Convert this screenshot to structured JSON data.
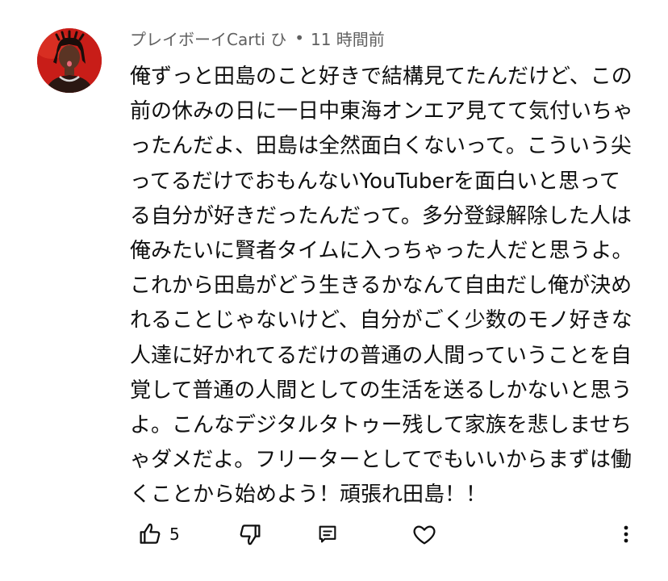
{
  "comment": {
    "author": "プレイボーイCarti ひ",
    "separator": "•",
    "timestamp": "11 時間前",
    "text": "俺ずっと田島のこと好きで結構見てたんだけど、この\n前の休みの日に一日中東海オンエア見てて気付いちゃ\nったんだよ、田島は全然面白くないって。こういう尖\nってるだけでおもんないYouTuberを面白いと思って\nる自分が好きだったんだって。多分登録解除した人は\n俺みたいに賢者タイムに入っちゃった人だと思うよ。\nこれから田島がどう生きるかなんて自由だし俺が決め\nれることじゃないけど、自分がごく少数のモノ好きな\n人達に好かれてるだけの普通の人間っていうことを自\n覚して普通の人間としての生活を送るしかないと思う\nよ。こんなデジタルタトゥー残して家族を悲しませち\nゃダメだよ。フリーターとしてでもいいからまずは働\nくことから始めよう！頑張れ田島！！",
    "like_count": "5"
  },
  "icons": {
    "avatar": "avatar-photo",
    "like": "thumbs-up-icon",
    "dislike": "thumbs-down-icon",
    "reply": "reply-icon",
    "heart": "heart-icon",
    "more": "more-vertical-icon"
  },
  "colors": {
    "text": "#0f0f0f",
    "meta": "#606060",
    "avatar_bg": "#c41a16"
  }
}
